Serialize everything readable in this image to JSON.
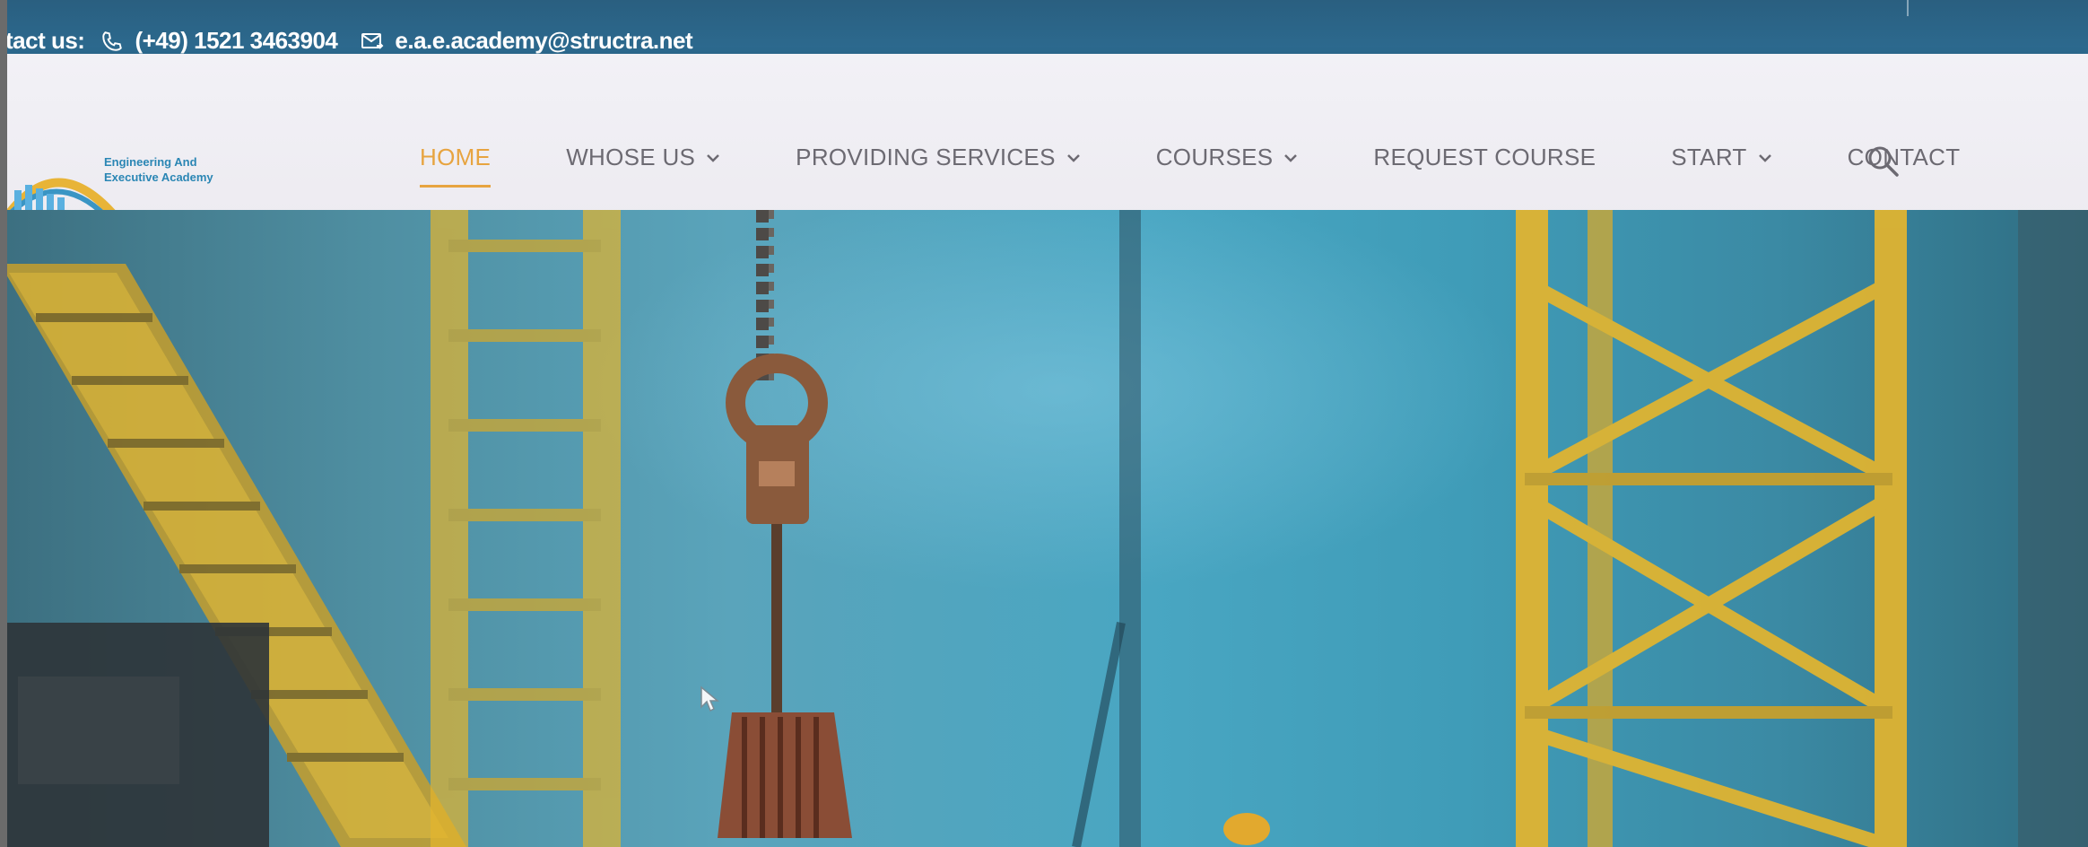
{
  "topbar": {
    "contact_label": "tact us:",
    "phone": "(+49) 1521 3463904",
    "email": "e.a.e.academy@structra.net",
    "phone_icon": "phone-icon",
    "email_icon": "mail-icon"
  },
  "logo": {
    "line1": "Engineering And",
    "line2": "Executive Academy"
  },
  "nav": {
    "items": [
      {
        "label": "HOME",
        "active": true,
        "dropdown": false
      },
      {
        "label": "WHOSE US",
        "active": false,
        "dropdown": true
      },
      {
        "label": "PROVIDING SERVICES",
        "active": false,
        "dropdown": true
      },
      {
        "label": "COURSES",
        "active": false,
        "dropdown": true
      },
      {
        "label": "REQUEST COURSE",
        "active": false,
        "dropdown": false
      },
      {
        "label": "START",
        "active": false,
        "dropdown": true
      },
      {
        "label": "CONTACT",
        "active": false,
        "dropdown": false
      }
    ],
    "search_icon": "search-icon"
  },
  "colors": {
    "topbar": "#2c6a8f",
    "accent": "#e7a440",
    "nav_text": "#6c6a72",
    "crane": "#e4b52e"
  }
}
